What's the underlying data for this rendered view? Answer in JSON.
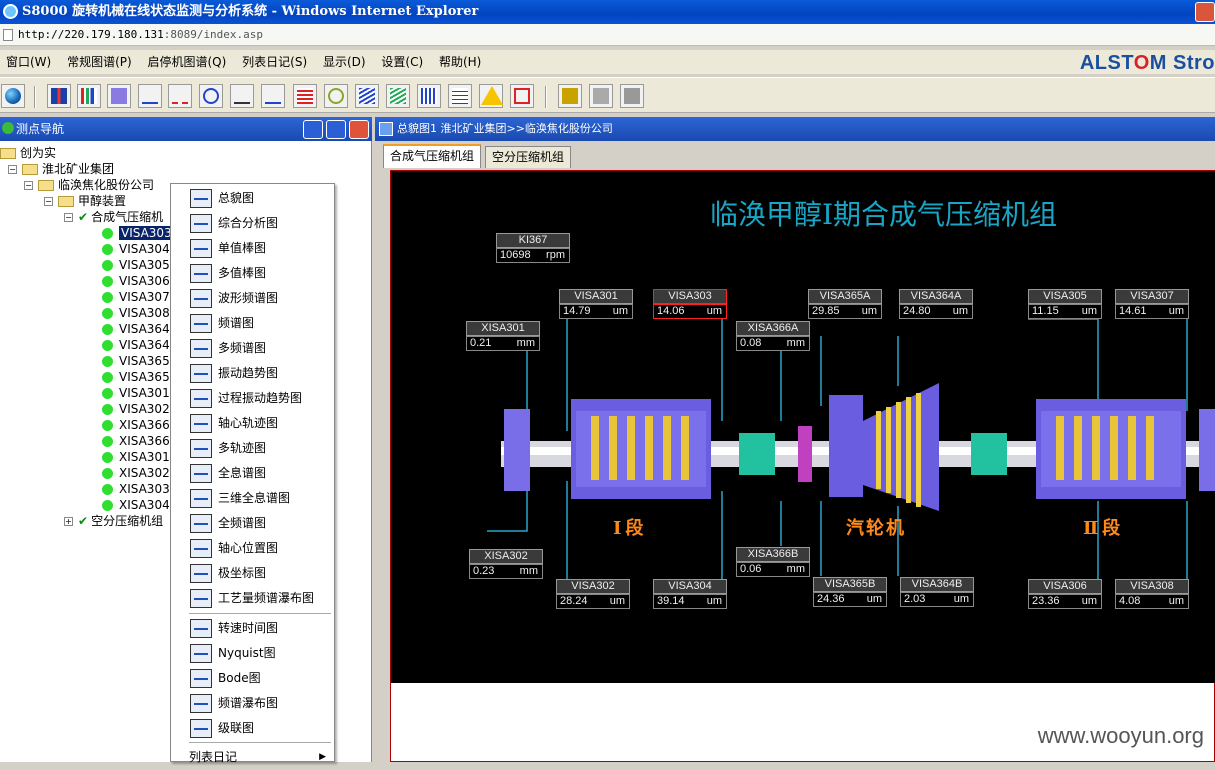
{
  "window": {
    "title": "S8000 旋转机械在线状态监测与分析系统 - Windows Internet Explorer"
  },
  "address": {
    "host": "http://220.179.180.131",
    "rest": ":8089/index.asp"
  },
  "menu": [
    "窗口(W)",
    "常规图谱(P)",
    "启停机图谱(Q)",
    "列表日记(S)",
    "显示(D)",
    "设置(C)",
    "帮助(H)"
  ],
  "brand": {
    "part1": "ALST",
    "o": "O",
    "part2": "M",
    "suffix": "Stro"
  },
  "nav": {
    "title": "测点导航",
    "tree": [
      {
        "label": "创为实",
        "level": 0,
        "kind": "folder"
      },
      {
        "label": "淮北矿业集团",
        "level": 1,
        "kind": "folder"
      },
      {
        "label": "临涣焦化股份公司",
        "level": 2,
        "kind": "folder"
      },
      {
        "label": "甲醇装置",
        "level": 3,
        "kind": "folder"
      },
      {
        "label": "合成气压缩机",
        "level": 4,
        "kind": "check"
      },
      {
        "label": "VISA303",
        "level": 5,
        "kind": "point",
        "selected": true
      },
      {
        "label": "VISA304",
        "level": 5,
        "kind": "point"
      },
      {
        "label": "VISA305",
        "level": 5,
        "kind": "point"
      },
      {
        "label": "VISA306",
        "level": 5,
        "kind": "point"
      },
      {
        "label": "VISA307",
        "level": 5,
        "kind": "point"
      },
      {
        "label": "VISA308",
        "level": 5,
        "kind": "point"
      },
      {
        "label": "VISA364",
        "level": 5,
        "kind": "point"
      },
      {
        "label": "VISA364",
        "level": 5,
        "kind": "point"
      },
      {
        "label": "VISA365",
        "level": 5,
        "kind": "point"
      },
      {
        "label": "VISA365",
        "level": 5,
        "kind": "point"
      },
      {
        "label": "VISA301",
        "level": 5,
        "kind": "point"
      },
      {
        "label": "VISA302",
        "level": 5,
        "kind": "point"
      },
      {
        "label": "XISA366",
        "level": 5,
        "kind": "point"
      },
      {
        "label": "XISA366",
        "level": 5,
        "kind": "point"
      },
      {
        "label": "XISA301",
        "level": 5,
        "kind": "point"
      },
      {
        "label": "XISA302",
        "level": 5,
        "kind": "point"
      },
      {
        "label": "XISA303",
        "level": 5,
        "kind": "point"
      },
      {
        "label": "XISA304",
        "level": 5,
        "kind": "point"
      },
      {
        "label": "空分压缩机组",
        "level": 4,
        "kind": "check"
      }
    ]
  },
  "context_menu": {
    "group1": [
      "总貌图",
      "综合分析图",
      "单值棒图",
      "多值棒图",
      "波形频谱图",
      "频谱图",
      "多频谱图",
      "振动趋势图",
      "过程振动趋势图",
      "轴心轨迹图",
      "多轨迹图",
      "全息谱图",
      "三维全息谱图",
      "全频谱图",
      "轴心位置图",
      "极坐标图",
      "工艺量频谱瀑布图"
    ],
    "group2": [
      "转速时间图",
      "Nyquist图",
      "Bode图",
      "频谱瀑布图",
      "级联图"
    ],
    "last": "列表日记"
  },
  "main": {
    "header": "总貌图1 淮北矿业集团>>临涣焦化股份公司",
    "tabs": [
      "合成气压缩机组",
      "空分压缩机组"
    ],
    "diagram_title": "临涣甲醇Ⅰ期合成气压缩机组",
    "stages": {
      "s1": "Ⅰ段",
      "turbine": "汽轮机",
      "s2": "Ⅱ段"
    },
    "tags": [
      {
        "name": "KI367",
        "value": "10698",
        "unit": "rpm"
      },
      {
        "name": "VISA301",
        "value": "14.79",
        "unit": "um"
      },
      {
        "name": "VISA303",
        "value": "14.06",
        "unit": "um"
      },
      {
        "name": "VISA365A",
        "value": "29.85",
        "unit": "um"
      },
      {
        "name": "VISA364A",
        "value": "24.80",
        "unit": "um"
      },
      {
        "name": "VISA305",
        "value": "11.15",
        "unit": "um"
      },
      {
        "name": "VISA307",
        "value": "14.61",
        "unit": "um"
      },
      {
        "name": "XISA301",
        "value": "0.21",
        "unit": "mm"
      },
      {
        "name": "XISA366A",
        "value": "0.08",
        "unit": "mm"
      },
      {
        "name": "XISA302",
        "value": "0.23",
        "unit": "mm"
      },
      {
        "name": "XISA366B",
        "value": "0.06",
        "unit": "mm"
      },
      {
        "name": "VISA302",
        "value": "28.24",
        "unit": "um"
      },
      {
        "name": "VISA304",
        "value": "39.14",
        "unit": "um"
      },
      {
        "name": "VISA365B",
        "value": "24.36",
        "unit": "um"
      },
      {
        "name": "VISA364B",
        "value": "2.03",
        "unit": "um"
      },
      {
        "name": "VISA306",
        "value": "23.36",
        "unit": "um"
      },
      {
        "name": "VISA308",
        "value": "4.08",
        "unit": "um"
      }
    ]
  },
  "watermark": "www.wooyun.org",
  "colors": {
    "title_bar": "#0a5ad8",
    "diagram_bg": "#000000",
    "title_cyan": "#18a6c7",
    "stage_orange": "#ff8a1a",
    "casing_purple": "#6a5de0",
    "shaft_white": "#f0f0f0",
    "highlight": "#ff2020"
  }
}
